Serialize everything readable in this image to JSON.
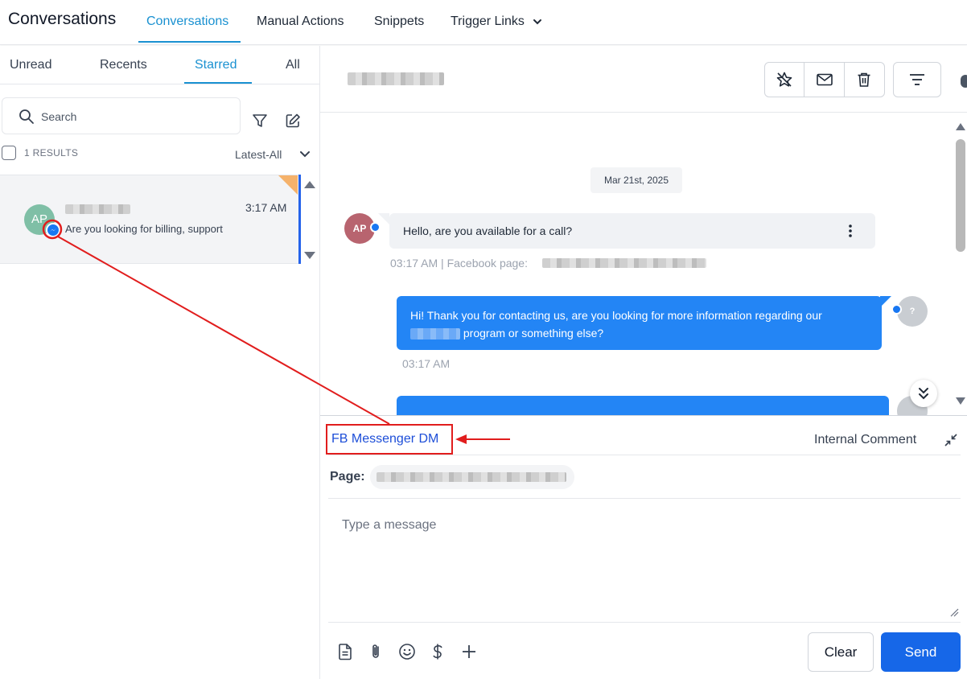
{
  "topnav": {
    "app_title": "Conversations",
    "tabs": [
      {
        "label": "Conversations",
        "active": true
      },
      {
        "label": "Manual Actions"
      },
      {
        "label": "Snippets"
      },
      {
        "label": "Trigger Links"
      }
    ]
  },
  "sidebar": {
    "tabs": [
      {
        "label": "Unread"
      },
      {
        "label": "Recents"
      },
      {
        "label": "Starred",
        "active": true
      },
      {
        "label": "All"
      }
    ],
    "search_placeholder": "Search",
    "results": "1 RESULTS",
    "sort": "Latest-All",
    "conversation": {
      "initials": "AP",
      "time": "3:17 AM",
      "snippet": "Are you looking for billing, support"
    }
  },
  "messages": {
    "date": "Mar 21st, 2025",
    "incoming": {
      "initials": "AP",
      "text": "Hello, are you available for a call?",
      "meta": "03:17 AM | Facebook page:"
    },
    "outgoing": {
      "initials": "?",
      "text_part1": "Hi! Thank you for contacting us, are you looking for more information regarding our",
      "text_part2": "program or something else?",
      "meta": "03:17 AM"
    }
  },
  "composer": {
    "channel": "FB Messenger DM",
    "internal": "Internal Comment",
    "page_label": "Page:",
    "placeholder": "Type a message",
    "clear_label": "Clear",
    "send_label": "Send"
  },
  "colors": {
    "accent": "#1a91d1",
    "messenger": "#1877f2",
    "outgoing_bubble": "#2385f5",
    "send": "#1667e8",
    "annotation": "#e11d1d"
  },
  "icons": [
    "search-icon",
    "filter-icon",
    "compose-icon",
    "chevron-down-icon",
    "messenger-icon",
    "star-icon",
    "mail-icon",
    "trash-icon",
    "sort-lines-icon",
    "kebab-icon",
    "double-chevron-down-icon",
    "collapse-icon",
    "document-icon",
    "paperclip-icon",
    "emoji-icon",
    "dollar-icon",
    "plus-icon"
  ]
}
